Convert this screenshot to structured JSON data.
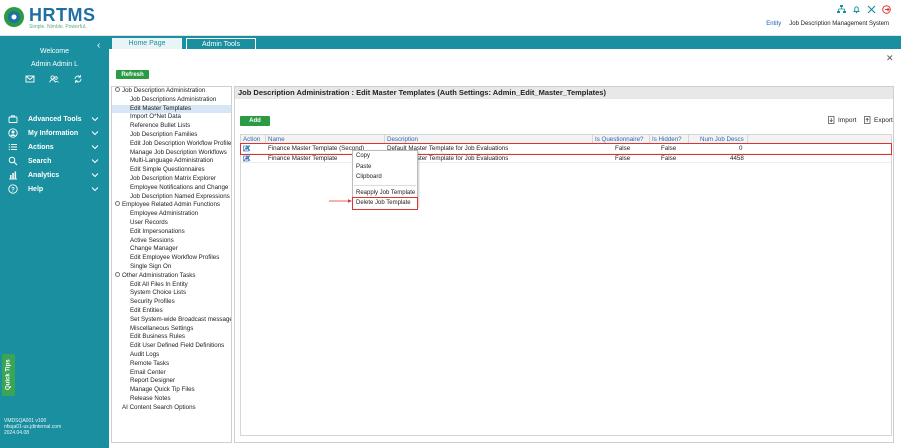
{
  "header": {
    "logo_name": "HRTMS",
    "logo_tagline": "Simple. Nimble. Powerful.",
    "entity_link": "Entity",
    "system_name": "Job Description Management System",
    "icons": [
      "org-chart-icon",
      "bell-icon",
      "tools-icon",
      "logout-icon"
    ]
  },
  "sidebar": {
    "welcome": "Welcome",
    "user": "Admin Admin L",
    "quick_icons": [
      "mail-icon",
      "users-icon",
      "sync-icon"
    ],
    "items": [
      {
        "label": "Advanced Tools",
        "icon": "briefcase-icon"
      },
      {
        "label": "My Information",
        "icon": "user-circle-icon"
      },
      {
        "label": "Actions",
        "icon": "list-icon"
      },
      {
        "label": "Search",
        "icon": "search-icon"
      },
      {
        "label": "Analytics",
        "icon": "chart-icon"
      },
      {
        "label": "Help",
        "icon": "help-icon"
      }
    ],
    "quick_tips": "Quick Tips",
    "version_lines": [
      "VMDSQA001 v100",
      "nfsqa01-us.jdinternal.com",
      "2024.04.08"
    ]
  },
  "tabs": [
    {
      "label": "Home Page"
    },
    {
      "label": "Admin Tools"
    }
  ],
  "refresh_label": "Refresh",
  "tree": [
    {
      "type": "group",
      "label": "Job Description Administration"
    },
    {
      "type": "child",
      "label": "Job Descriptions Administration"
    },
    {
      "type": "child",
      "label": "Edit Master Templates",
      "selected": true
    },
    {
      "type": "child",
      "label": "Import O*Net Data"
    },
    {
      "type": "child",
      "label": "Reference Bullet Lists"
    },
    {
      "type": "child",
      "label": "Job Description Families"
    },
    {
      "type": "child",
      "label": "Edit Job Description Workflow Profiles"
    },
    {
      "type": "child",
      "label": "Manage Job Description Workflows"
    },
    {
      "type": "child",
      "label": "Multi-Language Administration"
    },
    {
      "type": "child",
      "label": "Edit Simple Questionnaires"
    },
    {
      "type": "child",
      "label": "Job Description Matrix Explorer"
    },
    {
      "type": "child",
      "label": "Employee Notifications and Change"
    },
    {
      "type": "child",
      "label": "Job Description Named Expressions"
    },
    {
      "type": "group",
      "label": "Employee Related Admin Functions"
    },
    {
      "type": "child",
      "label": "Employee Administration"
    },
    {
      "type": "child",
      "label": "User Records"
    },
    {
      "type": "child",
      "label": "Edit Impersonations"
    },
    {
      "type": "child",
      "label": "Active Sessions"
    },
    {
      "type": "child",
      "label": "Change Manager"
    },
    {
      "type": "child",
      "label": "Edit Employee Workflow Profiles"
    },
    {
      "type": "child",
      "label": "Single Sign On"
    },
    {
      "type": "group",
      "label": "Other Administration Tasks"
    },
    {
      "type": "child",
      "label": "Edit All Files In Entity"
    },
    {
      "type": "child",
      "label": "System Choice Lists"
    },
    {
      "type": "child",
      "label": "Security Profiles"
    },
    {
      "type": "child",
      "label": "Edit Entities"
    },
    {
      "type": "child",
      "label": "Set System-wide Broadcast message"
    },
    {
      "type": "child",
      "label": "Miscellaneous Settings"
    },
    {
      "type": "child",
      "label": "Edit Business Rules"
    },
    {
      "type": "child",
      "label": "Edit User Defined Field Definitions"
    },
    {
      "type": "child",
      "label": "Audit Logs"
    },
    {
      "type": "child",
      "label": "Remote Tasks"
    },
    {
      "type": "child",
      "label": "Email Center"
    },
    {
      "type": "child",
      "label": "Report Designer"
    },
    {
      "type": "child",
      "label": "Manage Quick Tip Files"
    },
    {
      "type": "child",
      "label": "Release Notes"
    },
    {
      "type": "standalone",
      "label": "AI Content Search Options"
    }
  ],
  "main": {
    "title": "Job Description Administration : Edit Master Templates (Auth Settings: Admin_Edit_Master_Templates)",
    "add_label": "Add",
    "import_label": "Import",
    "export_label": "Export",
    "columns": [
      "Action",
      "Name",
      "Description",
      "Is Questionnaire?",
      "Is Hidden?",
      "Num Job Descs"
    ],
    "rows": [
      {
        "name": "Finance Master Template (Second)",
        "description": "Default Master Template for Job Evaluations",
        "questionnaire": "False",
        "hidden": "False",
        "num": "0"
      },
      {
        "name": "Finance Master Template",
        "description": "Default Master Template for Job Evaluations",
        "questionnaire": "False",
        "hidden": "False",
        "num": "4458"
      }
    ]
  },
  "context_menu": {
    "items": [
      "Copy",
      "Paste",
      "Clipboard",
      "Reapply Job Template",
      "Delete Job Template"
    ]
  },
  "colors": {
    "sidebar": "#1a8fa0",
    "button_green": "#2a9a44",
    "highlight_red": "#d33"
  }
}
